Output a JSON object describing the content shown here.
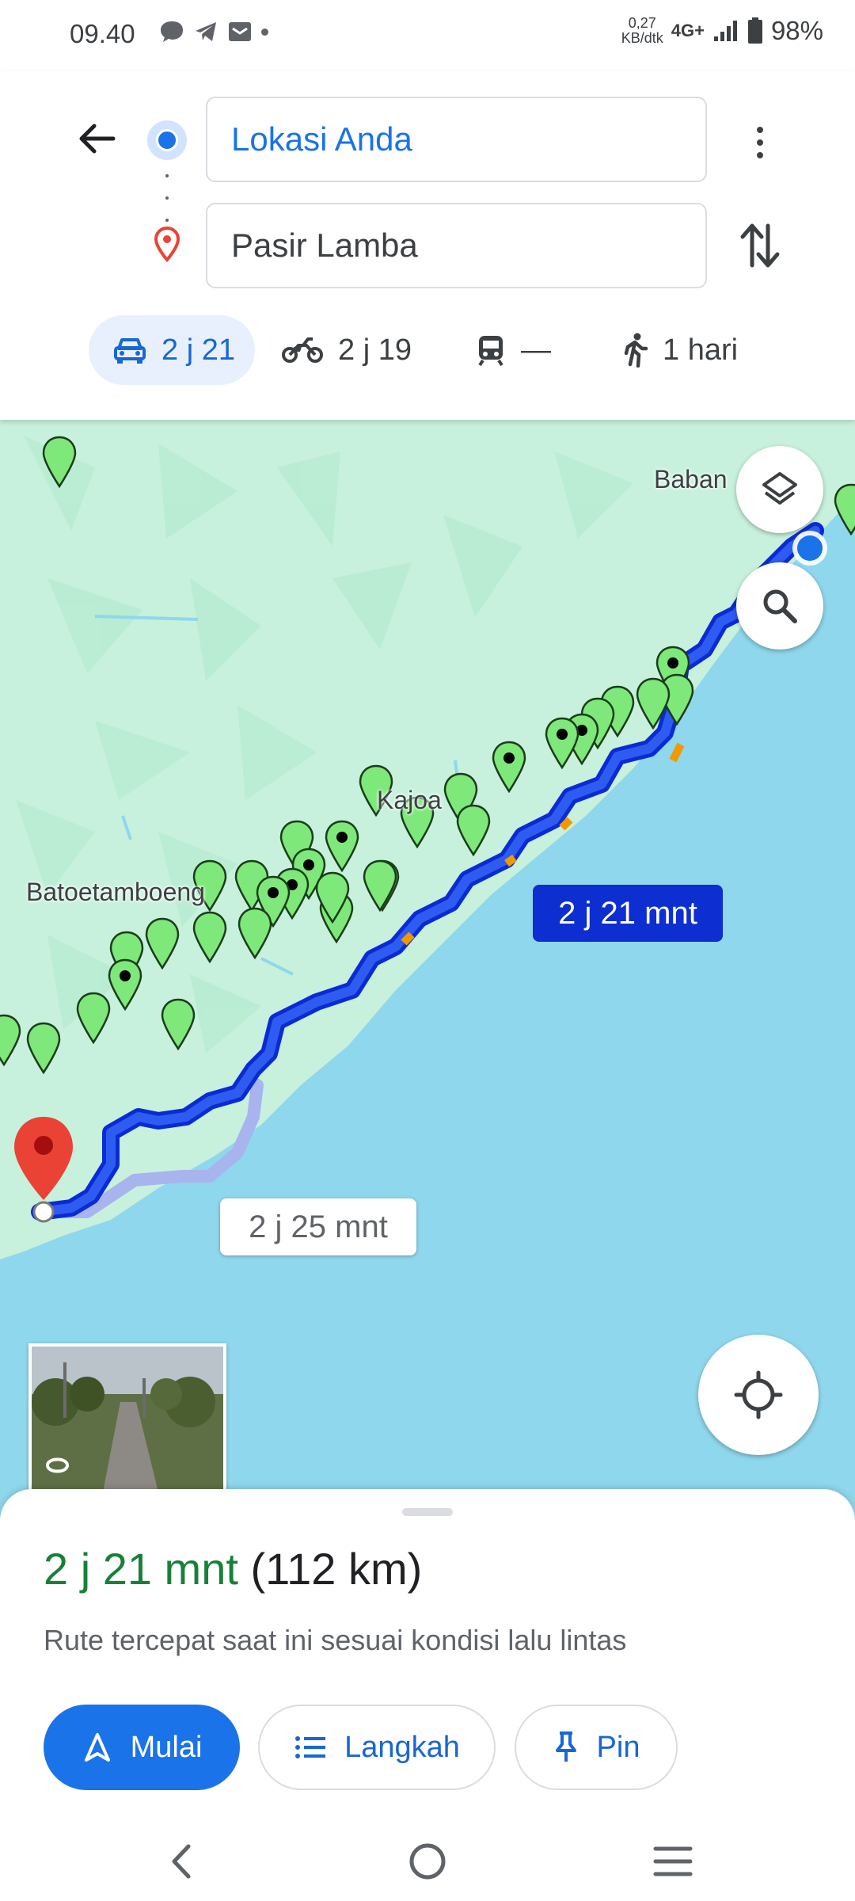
{
  "status_bar": {
    "time": "09.40",
    "net_speed_value": "0,27",
    "net_speed_unit": "KB/dtk",
    "network": "4G+",
    "battery": "98%",
    "notification_icons": [
      "chat-bubble-icon",
      "telegram-icon",
      "mail-icon"
    ]
  },
  "directions": {
    "origin": "Lokasi Anda",
    "destination": "Pasir Lamba"
  },
  "travel_modes": [
    {
      "mode": "car",
      "icon": "car-icon",
      "label": "2 j 21",
      "active": true
    },
    {
      "mode": "motorcycle",
      "icon": "motorcycle-icon",
      "label": "2 j 19",
      "active": false
    },
    {
      "mode": "transit",
      "icon": "train-icon",
      "label": "—",
      "active": false
    },
    {
      "mode": "walk",
      "icon": "walk-icon",
      "label": "1 hari",
      "active": false
    }
  ],
  "map": {
    "place_labels": [
      "Baban",
      "Kajoa",
      "Batoetamboeng"
    ],
    "primary_route_label": "2 j 21 mnt",
    "alternate_route_label": "2 j 25 mnt",
    "colors": {
      "land": "#c7f1dc",
      "water": "#8fd7ec",
      "route": "#1a3de8",
      "alt_route": "#a8b4ee",
      "pin": "#7ee87a"
    }
  },
  "sheet": {
    "duration": "2 j 21 mnt",
    "distance": "(112 km)",
    "description": "Rute tercepat saat ini sesuai kondisi lalu lintas",
    "buttons": {
      "start": "Mulai",
      "steps": "Langkah",
      "pin": "Pin"
    }
  }
}
